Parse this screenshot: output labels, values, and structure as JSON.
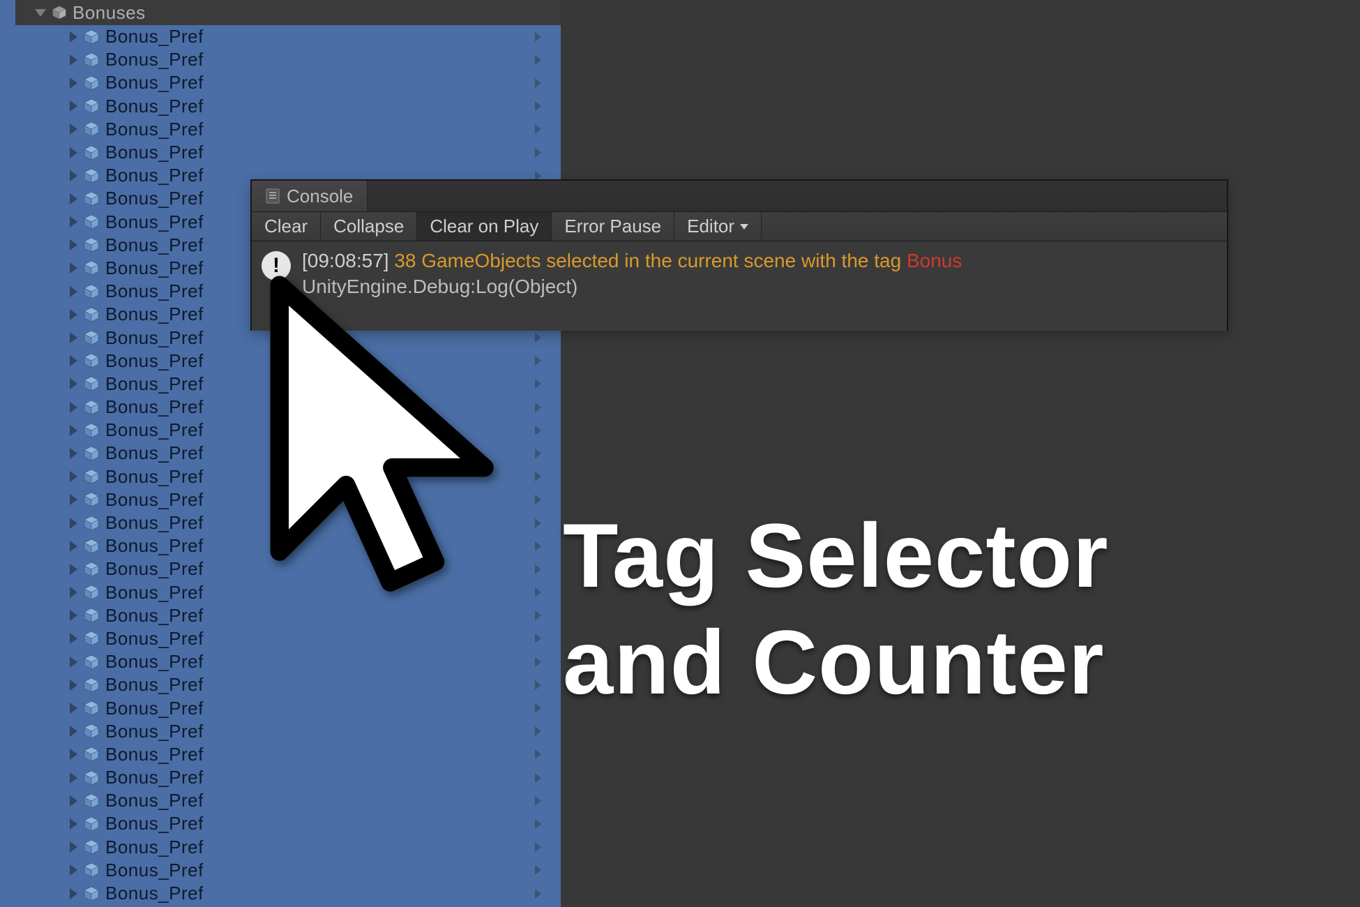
{
  "hierarchy": {
    "root_label": "Bonuses",
    "child_label": "Bonus_Pref",
    "child_count": 38
  },
  "console": {
    "tab_label": "Console",
    "toolbar": {
      "clear": "Clear",
      "collapse": "Collapse",
      "clear_on_play": "Clear on Play",
      "error_pause": "Error Pause",
      "editor": "Editor"
    },
    "log": {
      "timestamp": "[09:08:57]",
      "message": "38 GameObjects selected in the current scene with the tag ",
      "tag": "Bonus",
      "line2": "UnityEngine.Debug:Log(Object)"
    }
  },
  "promo": {
    "line1": "Tag Selector",
    "line2": "and Counter"
  }
}
